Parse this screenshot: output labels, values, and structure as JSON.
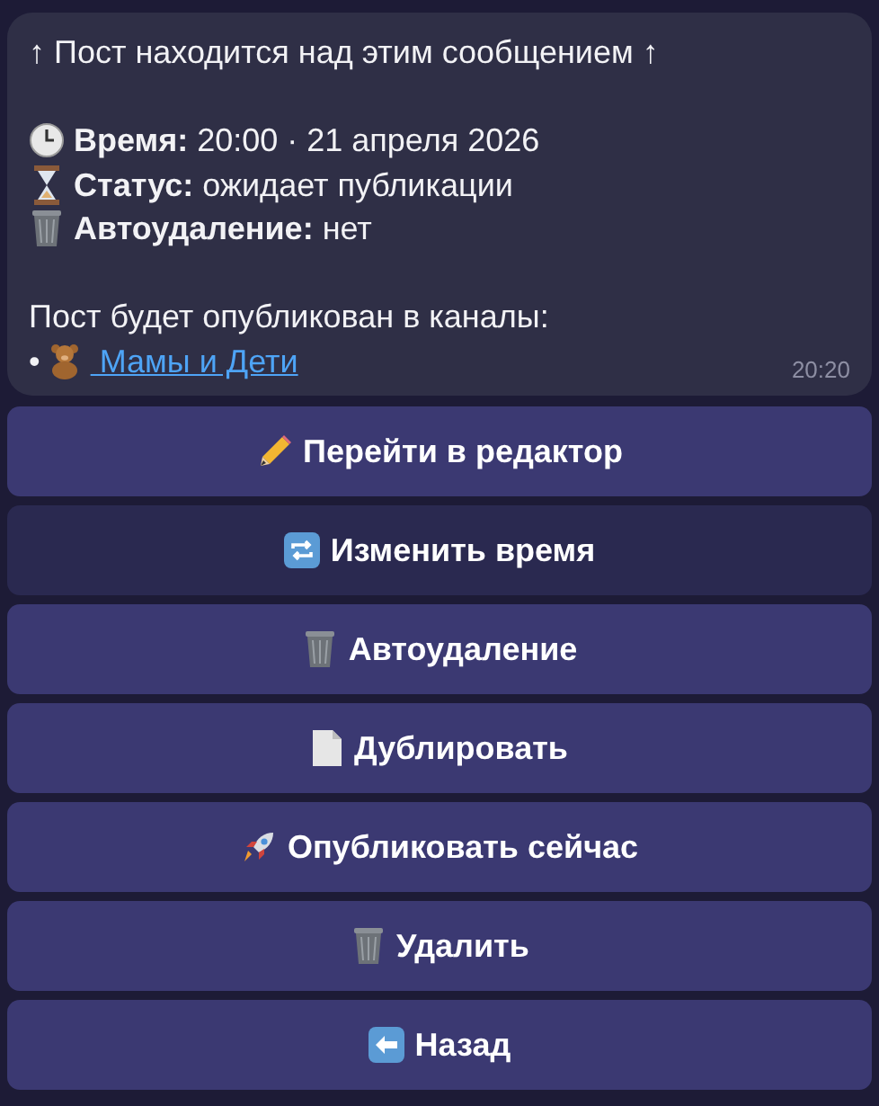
{
  "message": {
    "header": "↑ Пост находится над этим сообщением ↑",
    "details": [
      "**Время:** 20:00 · 21 апреля 2026",
      "**Статус:** ожидает публикации",
      "**Автоудаление:** нет"
    ],
    "channels_label": "Пост будет опубликован в каналы:",
    "channels": [
      {
        "bullet": "•",
        "name": " Мамы и Дети"
      }
    ],
    "time": "20:20"
  },
  "buttons": [
    {
      "label": "Перейти в редактор",
      "highlighted": false
    },
    {
      "label": "Изменить время",
      "highlighted": true
    },
    {
      "label": "Автоудаление",
      "highlighted": false
    },
    {
      "label": "Дублировать",
      "highlighted": false
    },
    {
      "label": "Опубликовать сейчас",
      "highlighted": false
    },
    {
      "label": "Удалить",
      "highlighted": false
    },
    {
      "label": "Назад",
      "highlighted": false
    }
  ]
}
